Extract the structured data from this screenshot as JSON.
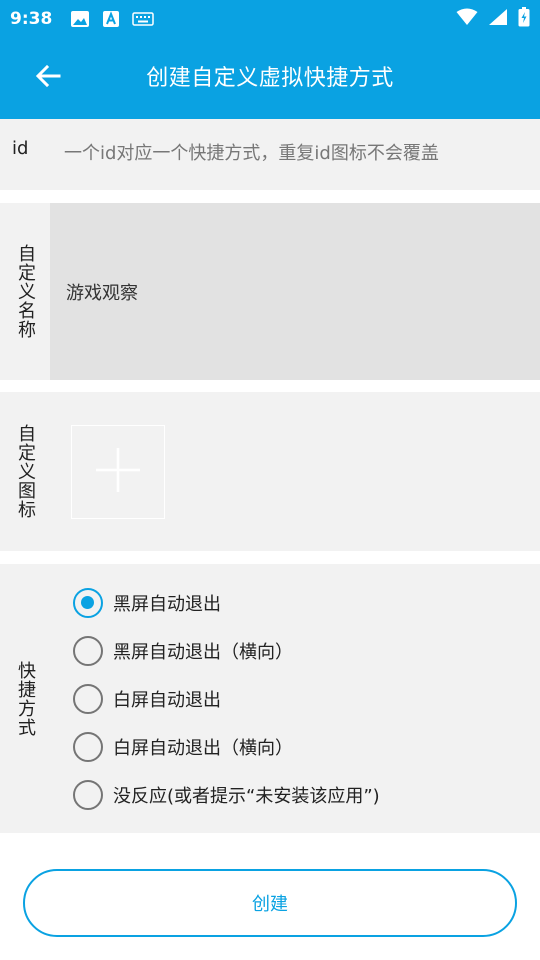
{
  "status_bar": {
    "time": "9:38",
    "left_icons": [
      "image-icon",
      "a-keyboard-icon",
      "keyboard-icon"
    ],
    "right_icons": [
      "wifi-icon",
      "signal-icon",
      "battery-icon"
    ]
  },
  "app_bar": {
    "title": "创建自定义虚拟快捷方式",
    "back_icon": "arrow-left-icon",
    "color": "#0aa2e2"
  },
  "form": {
    "id": {
      "label": "id",
      "placeholder": "一个id对应一个快捷方式，重复id图标不会覆盖",
      "value": ""
    },
    "name": {
      "label": "自定义名称",
      "value": "游戏观察"
    },
    "icon": {
      "label": "自定义图标",
      "picker_icon": "plus-icon"
    },
    "mode": {
      "label": "快捷方式",
      "selected_index": 0,
      "options": [
        "黑屏自动退出",
        "黑屏自动退出（横向）",
        "白屏自动退出",
        "白屏自动退出（横向）",
        "没反应(或者提示“未安装该应用”)"
      ]
    }
  },
  "create_button": {
    "label": "创建"
  }
}
